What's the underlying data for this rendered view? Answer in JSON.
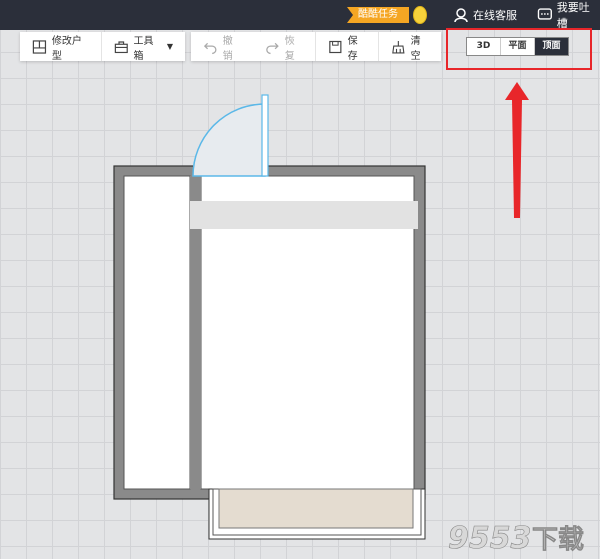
{
  "topbar": {
    "task_badge": "酷酷任务",
    "service_label": "在线客服",
    "feedback_label": "我要吐槽"
  },
  "toolbar": {
    "edit_plan": "修改户型",
    "toolbox": "工具箱",
    "undo": "撤销",
    "redo": "恢复",
    "save": "保存",
    "clear": "清空"
  },
  "view_switch": {
    "options": [
      "3D",
      "平面",
      "顶面"
    ],
    "active": "顶面"
  },
  "colors": {
    "topbar": "#2b2f3a",
    "badge": "#f5a623",
    "highlight": "#e8262a",
    "wall": "#8a8a8a",
    "door": "#5bb8e8",
    "balcony_floor": "#e4dcd0"
  },
  "watermark": "9553下载"
}
